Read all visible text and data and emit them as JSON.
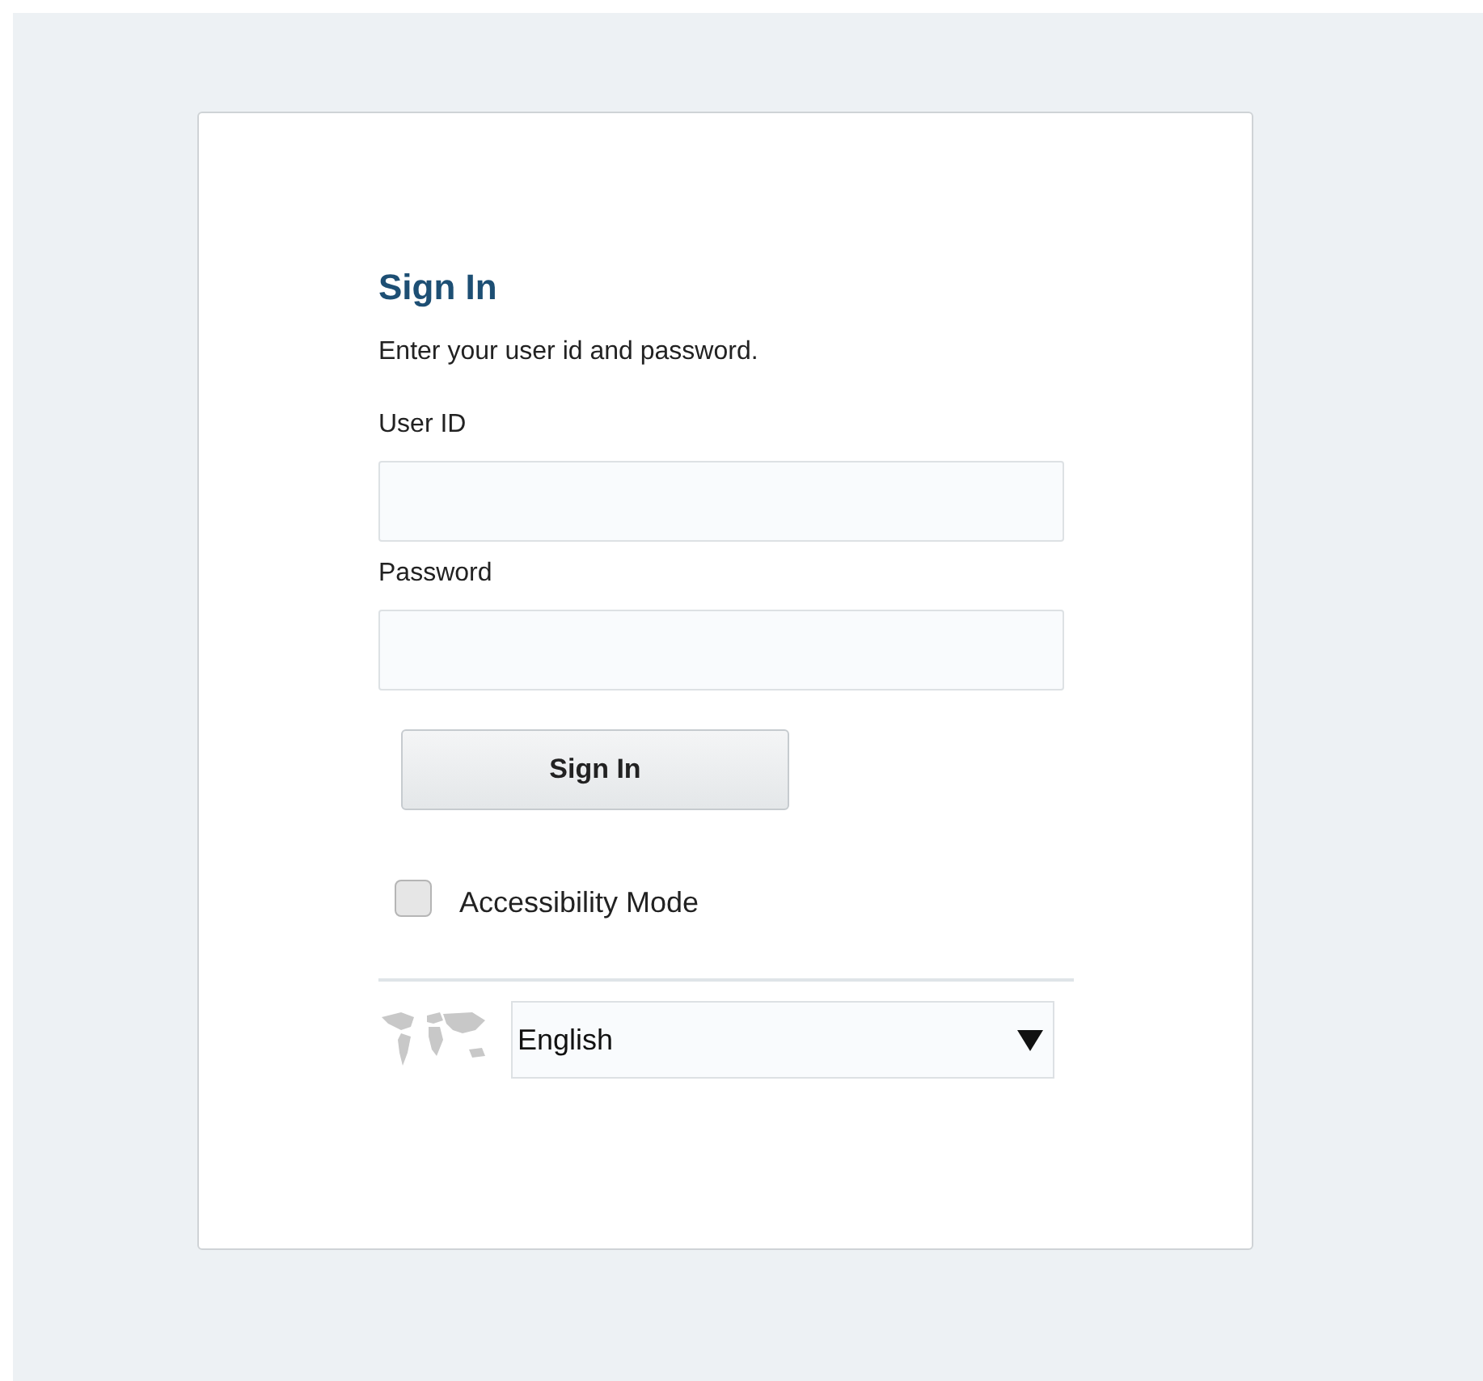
{
  "title": "Sign In",
  "instruction": "Enter your user id and password.",
  "fields": [
    {
      "label": "User ID"
    },
    {
      "label": "Password"
    }
  ],
  "submit": "Sign In",
  "accessibility": {
    "label": "Accessibility Mode",
    "checked": false
  },
  "language": {
    "value": "English"
  }
}
